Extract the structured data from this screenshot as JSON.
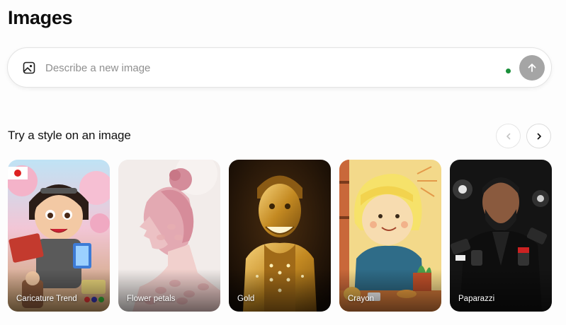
{
  "page": {
    "title": "Images"
  },
  "composer": {
    "placeholder": "Describe a new image",
    "icon": "image-icon",
    "send_icon": "arrow-up-icon",
    "status_color": "#1a8f3a"
  },
  "styles_section": {
    "title": "Try a style on an image",
    "prev_icon": "chevron-left-icon",
    "next_icon": "chevron-right-icon",
    "cards": [
      {
        "label": "Caricature Trend"
      },
      {
        "label": "Flower petals"
      },
      {
        "label": "Gold"
      },
      {
        "label": "Crayon"
      },
      {
        "label": "Paparazzi"
      }
    ]
  }
}
